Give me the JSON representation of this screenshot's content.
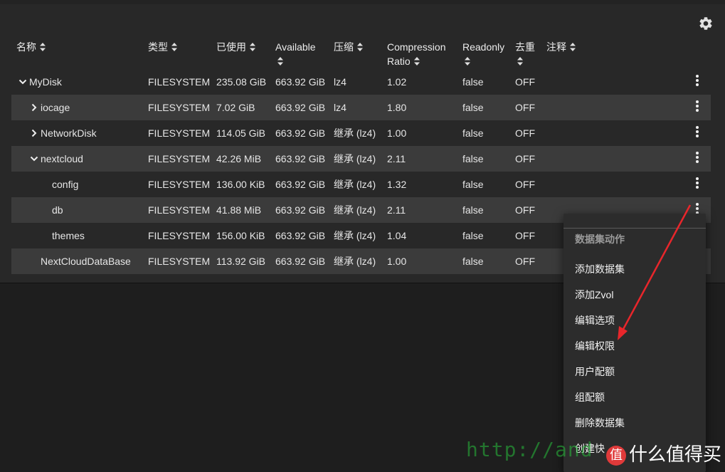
{
  "columns": [
    {
      "key": "name",
      "label": "名称"
    },
    {
      "key": "type",
      "label": "类型"
    },
    {
      "key": "used",
      "label": "已使用"
    },
    {
      "key": "available",
      "label": "Available"
    },
    {
      "key": "compression",
      "label": "压缩"
    },
    {
      "key": "ratio_line1",
      "label": "Compression"
    },
    {
      "key": "ratio_line2",
      "label": "Ratio"
    },
    {
      "key": "readonly",
      "label": "Readonly"
    },
    {
      "key": "dedup",
      "label": "去重"
    },
    {
      "key": "comments",
      "label": "注释"
    }
  ],
  "rows": [
    {
      "name": "MyDisk",
      "type": "FILESYSTEM",
      "used": "235.08 GiB",
      "available": "663.92 GiB",
      "compression": "lz4",
      "ratio": "1.02",
      "readonly": "false",
      "dedup": "OFF",
      "expand": "expanded"
    },
    {
      "name": "iocage",
      "type": "FILESYSTEM",
      "used": "7.02 GiB",
      "available": "663.92 GiB",
      "compression": "lz4",
      "ratio": "1.80",
      "readonly": "false",
      "dedup": "OFF",
      "expand": "collapsed"
    },
    {
      "name": "NetworkDisk",
      "type": "FILESYSTEM",
      "used": "114.05 GiB",
      "available": "663.92 GiB",
      "compression": "继承 (lz4)",
      "ratio": "1.00",
      "readonly": "false",
      "dedup": "OFF",
      "expand": "collapsed"
    },
    {
      "name": "nextcloud",
      "type": "FILESYSTEM",
      "used": "42.26 MiB",
      "available": "663.92 GiB",
      "compression": "继承 (lz4)",
      "ratio": "2.11",
      "readonly": "false",
      "dedup": "OFF",
      "expand": "expanded"
    },
    {
      "name": "config",
      "type": "FILESYSTEM",
      "used": "136.00 KiB",
      "available": "663.92 GiB",
      "compression": "继承 (lz4)",
      "ratio": "1.32",
      "readonly": "false",
      "dedup": "OFF",
      "expand": "none"
    },
    {
      "name": "db",
      "type": "FILESYSTEM",
      "used": "41.88 MiB",
      "available": "663.92 GiB",
      "compression": "继承 (lz4)",
      "ratio": "2.11",
      "readonly": "false",
      "dedup": "OFF",
      "expand": "none"
    },
    {
      "name": "themes",
      "type": "FILESYSTEM",
      "used": "156.00 KiB",
      "available": "663.92 GiB",
      "compression": "继承 (lz4)",
      "ratio": "1.04",
      "readonly": "false",
      "dedup": "OFF",
      "expand": "none"
    },
    {
      "name": "NextCloudDataBase",
      "type": "FILESYSTEM",
      "used": "113.92 GiB",
      "available": "663.92 GiB",
      "compression": "继承 (lz4)",
      "ratio": "1.00",
      "readonly": "false",
      "dedup": "OFF",
      "expand": "none"
    }
  ],
  "menu": {
    "title": "数据集动作",
    "items": [
      "添加数据集",
      "添加Zvol",
      "编辑选项",
      "编辑权限",
      "用户配额",
      "组配额",
      "删除数据集",
      "创建快"
    ]
  },
  "watermark": {
    "url": "http://and",
    "brand": "什么值得买",
    "logo": "值"
  },
  "colors": {
    "background": "#1e1e1e",
    "panel": "#282828",
    "row_alt": "#3b3b3b",
    "arrow": "#e8262b",
    "watermark_green": "#28be3c"
  },
  "icons": {
    "settings": "gear-icon",
    "sort": "sort-updown-icon",
    "row_actions": "more-vert-icon",
    "expand": "chevron-down-icon",
    "collapse": "chevron-right-icon"
  }
}
